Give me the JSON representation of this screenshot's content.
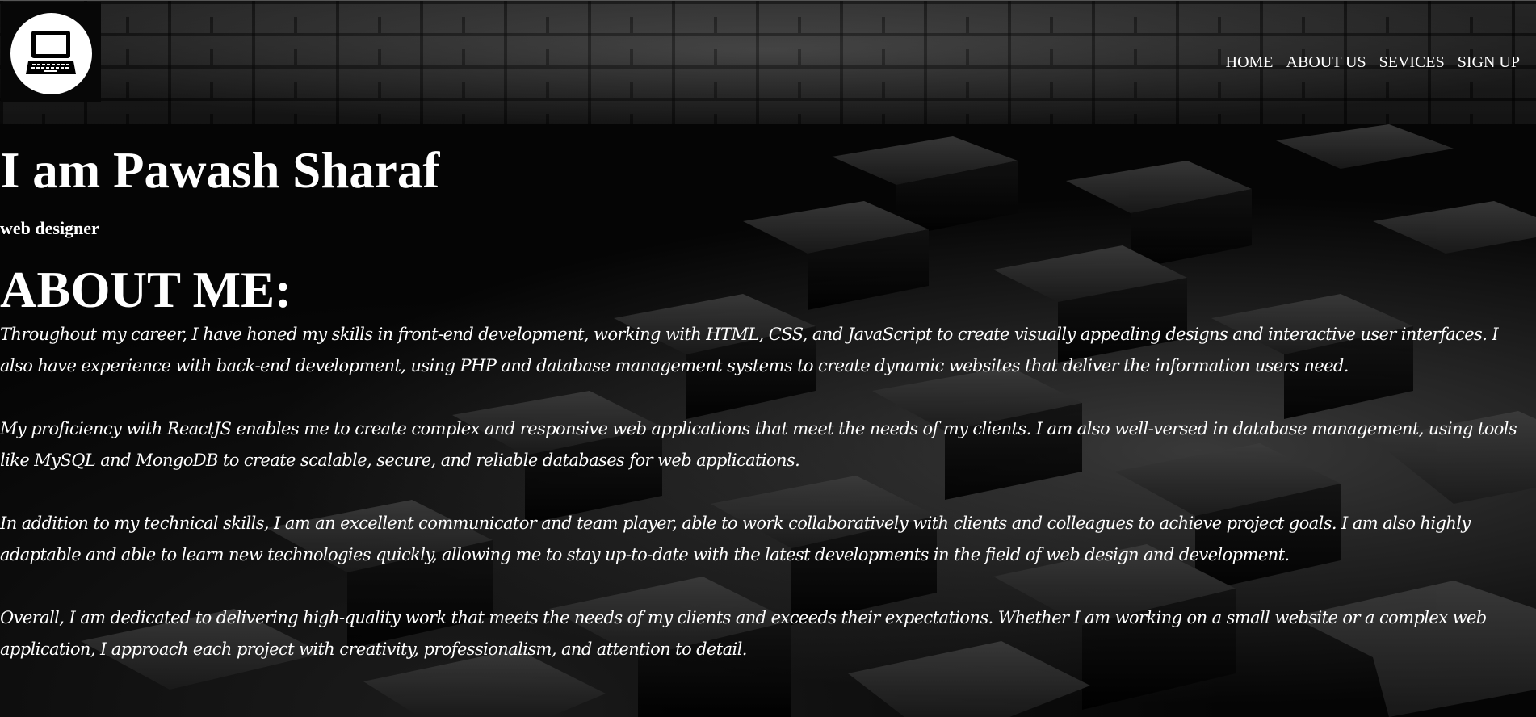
{
  "header": {
    "logo_icon": "laptop-icon",
    "nav": [
      {
        "label": "HOME"
      },
      {
        "label": "ABOUT US"
      },
      {
        "label": "SEVICES"
      },
      {
        "label": "SIGN UP"
      }
    ]
  },
  "hero": {
    "title": "I am Pawash Sharaf",
    "role": "web designer"
  },
  "about": {
    "heading": "ABOUT ME:",
    "paragraphs": [
      "Throughout my career, I have honed my skills in front-end development, working with HTML, CSS, and JavaScript to create visually appealing designs and interactive user interfaces. I also have experience with back-end development, using PHP and database management systems to create dynamic websites that deliver the information users need.",
      "My proficiency with ReactJS enables me to create complex and responsive web applications that meet the needs of my clients. I am also well-versed in database management, using tools like MySQL and MongoDB to create scalable, secure, and reliable databases for web applications.",
      "In addition to my technical skills, I am an excellent communicator and team player, able to work collaboratively with clients and colleagues to achieve project goals. I am also highly adaptable and able to learn new technologies quickly, allowing me to stay up-to-date with the latest developments in the field of web design and development.",
      "Overall, I am dedicated to delivering high-quality work that meets the needs of my clients and exceeds their expectations. Whether I am working on a small website or a complex web application, I approach each project with creativity, professionalism, and attention to detail."
    ]
  },
  "colors": {
    "background": "#000000",
    "text": "#ffffff",
    "logo_circle": "#ffffff"
  }
}
